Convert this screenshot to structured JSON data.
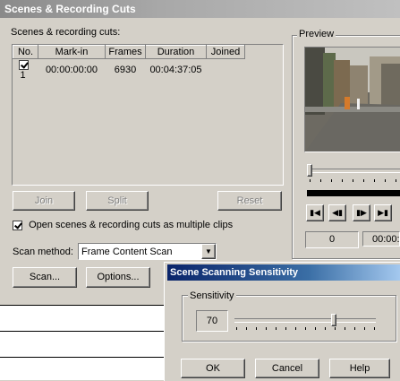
{
  "window": {
    "title": "Scenes & Recording Cuts"
  },
  "cuts": {
    "group_label": "Scenes & recording cuts:",
    "columns": [
      "No.",
      "Mark-in",
      "Frames",
      "Duration",
      "Joined"
    ],
    "rows": [
      {
        "no": "1",
        "mark_in": "00:00:00:00",
        "frames": "6930",
        "duration": "00:04:37:05",
        "joined": "",
        "checked": true
      }
    ]
  },
  "buttons": {
    "join": "Join",
    "split": "Split",
    "reset": "Reset",
    "scan": "Scan...",
    "options": "Options..."
  },
  "open_multiple": {
    "label": "Open scenes & recording cuts as multiple clips",
    "checked": true
  },
  "scan_method": {
    "label": "Scan method:",
    "value": "Frame Content Scan"
  },
  "preview": {
    "label": "Preview",
    "frame_value": "0",
    "timecode": "00:00:"
  },
  "sensitivity_dialog": {
    "title": "Scene Scanning Sensitivity",
    "group_label": "Sensitivity",
    "value": "70",
    "level": 0.7,
    "ok": "OK",
    "cancel": "Cancel",
    "help": "Help"
  }
}
